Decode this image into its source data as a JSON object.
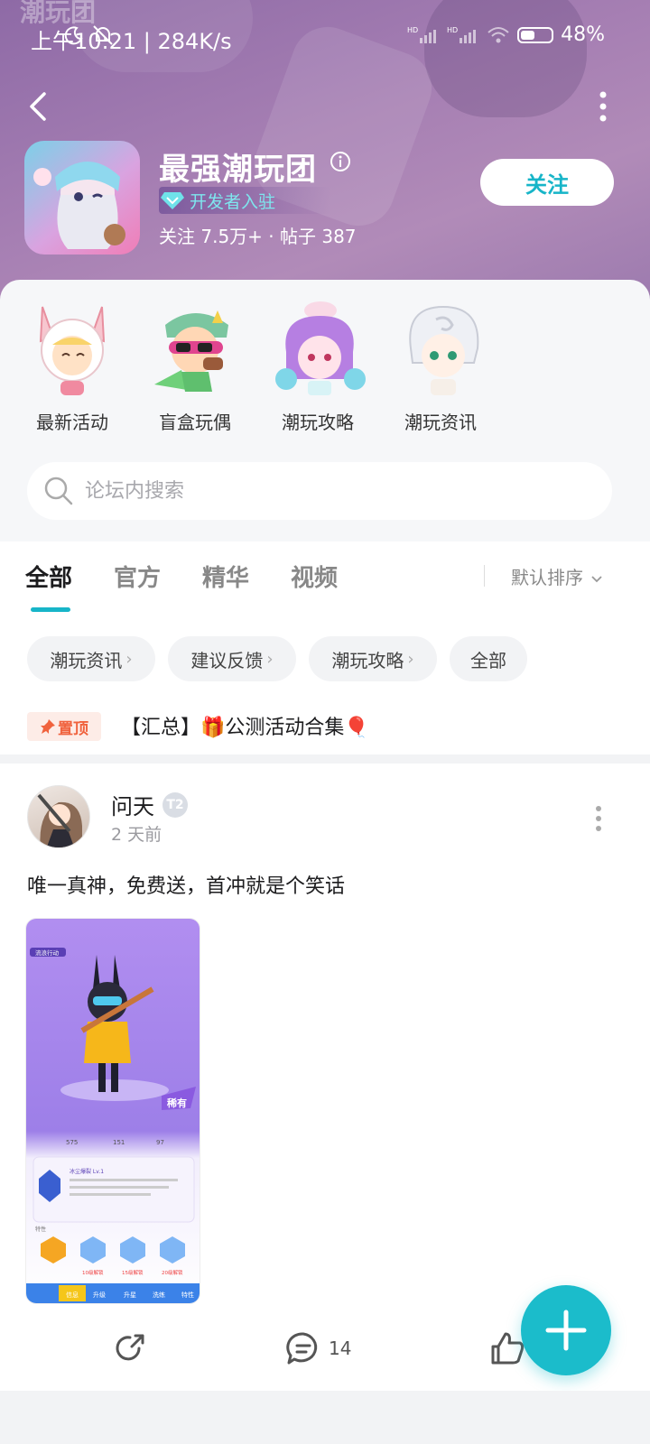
{
  "status_bar": {
    "time": "上午10:21 | 284K/s",
    "battery": "48%",
    "battery_level": 0.48
  },
  "header": {
    "watermark": "潮玩团",
    "title": "最强潮玩团",
    "badge": "开发者入驻",
    "stats": "关注 7.5万+ · 帖子 387",
    "follow_label": "关注"
  },
  "shortcuts": [
    {
      "label": "最新活动",
      "icon": "bunny-hood-character-icon"
    },
    {
      "label": "盲盒玩偶",
      "icon": "sunglasses-character-icon"
    },
    {
      "label": "潮玩攻略",
      "icon": "purple-hair-character-icon"
    },
    {
      "label": "潮玩资讯",
      "icon": "white-hair-character-icon"
    }
  ],
  "search": {
    "placeholder": "论坛内搜索"
  },
  "tabs": [
    {
      "label": "全部",
      "active": true
    },
    {
      "label": "官方",
      "active": false
    },
    {
      "label": "精华",
      "active": false
    },
    {
      "label": "视频",
      "active": false
    }
  ],
  "sort_label": "默认排序",
  "chips": [
    {
      "label": "潮玩资讯",
      "arrow": "›"
    },
    {
      "label": "建议反馈",
      "arrow": "›"
    },
    {
      "label": "潮玩攻略",
      "arrow": "›"
    },
    {
      "label": "全部",
      "arrow": ""
    }
  ],
  "pinned": {
    "badge": "置顶",
    "title": "【汇总】🎁公测活动合集🎈"
  },
  "post": {
    "author": "问天",
    "level": "T2",
    "time": "2 天前",
    "text": "唯一真神，免费送，首冲就是个笑话",
    "comments": "14",
    "image_text": {
      "name": "流浪行动",
      "rarity": "稀有",
      "stat1": "575",
      "stat2": "151",
      "stat3": "97",
      "skill": "冰尘爆裂 Lv.1",
      "trait_label": "特性",
      "unlock_a": "10级解锁",
      "unlock_b": "15级解锁",
      "unlock_c": "20级解锁",
      "bottom_tabs": [
        "信息",
        "升级",
        "升星",
        "洗练",
        "特性"
      ]
    }
  },
  "colors": {
    "accent": "#17b5c8",
    "header_bg": "#a67fb3",
    "pin_red": "#f0623d"
  }
}
